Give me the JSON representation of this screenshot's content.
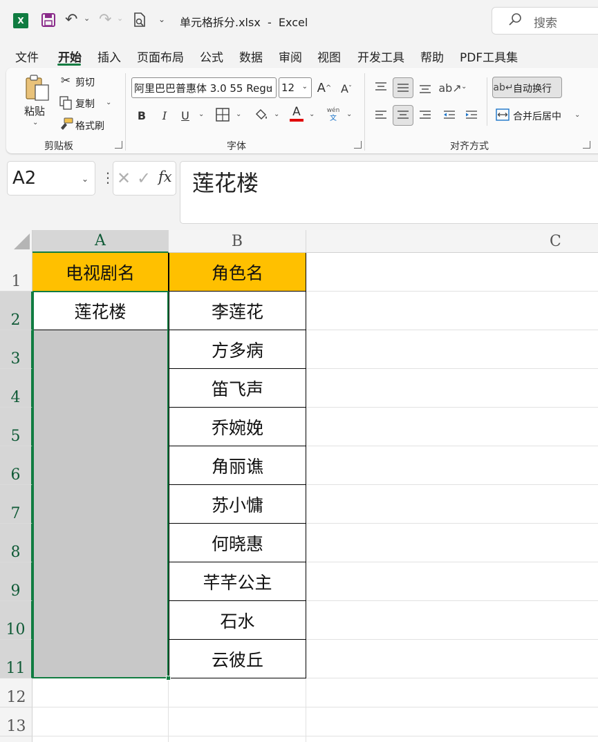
{
  "window": {
    "file_title": "单元格拆分.xlsx  -  Excel",
    "search_placeholder": "搜索"
  },
  "tabs": [
    "文件",
    "开始",
    "插入",
    "页面布局",
    "公式",
    "数据",
    "审阅",
    "视图",
    "开发工具",
    "帮助",
    "PDF工具集"
  ],
  "active_tab": "开始",
  "ribbon": {
    "clipboard": {
      "paste": "粘贴",
      "cut": "剪切",
      "copy": "复制",
      "format_painter": "格式刷",
      "group_label": "剪贴板"
    },
    "font": {
      "font_name": "阿里巴巴普惠体 3.0 55 Regu",
      "font_size": "12",
      "bold": "B",
      "italic": "I",
      "underline": "U",
      "phonetic_top": "wén",
      "phonetic_bottom": "文",
      "group_label": "字体",
      "font_color": "#e00000"
    },
    "alignment": {
      "wrap_text": "自动换行",
      "merge_center": "合并后居中",
      "group_label": "对齐方式"
    }
  },
  "formula_bar": {
    "name_box": "A2",
    "fx_label": "fx",
    "formula": "莲花楼"
  },
  "sheet": {
    "columns": [
      "A",
      "B",
      "C"
    ],
    "rows": [
      "1",
      "2",
      "3",
      "4",
      "5",
      "6",
      "7",
      "8",
      "9",
      "10",
      "11",
      "12",
      "13"
    ],
    "header_row": [
      "电视剧名",
      "角色名"
    ],
    "column_a": [
      "莲花楼"
    ],
    "column_b": [
      "李莲花",
      "方多病",
      "笛飞声",
      "乔婉娩",
      "角丽谯",
      "苏小慵",
      "何晓惠",
      "芊芊公主",
      "石水",
      "云彼丘"
    ],
    "header_fill": "#ffc000",
    "selection_color": "#107c41"
  }
}
